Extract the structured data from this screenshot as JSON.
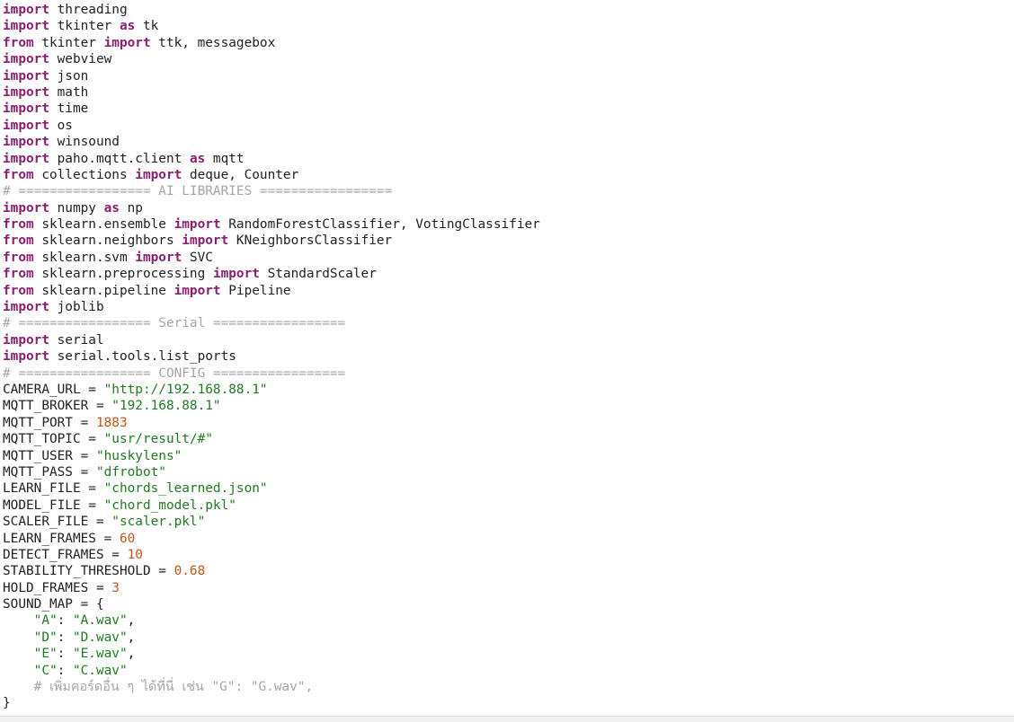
{
  "editor": {
    "lines": [
      [
        {
          "t": "kw",
          "v": "import"
        },
        {
          "t": "plain",
          "v": " threading"
        }
      ],
      [
        {
          "t": "kw",
          "v": "import"
        },
        {
          "t": "plain",
          "v": " tkinter "
        },
        {
          "t": "kw",
          "v": "as"
        },
        {
          "t": "plain",
          "v": " tk"
        }
      ],
      [
        {
          "t": "kw",
          "v": "from"
        },
        {
          "t": "plain",
          "v": " tkinter "
        },
        {
          "t": "kw",
          "v": "import"
        },
        {
          "t": "plain",
          "v": " ttk, messagebox"
        }
      ],
      [
        {
          "t": "kw",
          "v": "import"
        },
        {
          "t": "plain",
          "v": " webview"
        }
      ],
      [
        {
          "t": "kw",
          "v": "import"
        },
        {
          "t": "plain",
          "v": " json"
        }
      ],
      [
        {
          "t": "kw",
          "v": "import"
        },
        {
          "t": "plain",
          "v": " math"
        }
      ],
      [
        {
          "t": "kw",
          "v": "import"
        },
        {
          "t": "plain",
          "v": " time"
        }
      ],
      [
        {
          "t": "kw",
          "v": "import"
        },
        {
          "t": "plain",
          "v": " os"
        }
      ],
      [
        {
          "t": "kw",
          "v": "import"
        },
        {
          "t": "plain",
          "v": " winsound"
        }
      ],
      [
        {
          "t": "kw",
          "v": "import"
        },
        {
          "t": "plain",
          "v": " paho.mqtt.client "
        },
        {
          "t": "kw",
          "v": "as"
        },
        {
          "t": "plain",
          "v": " mqtt"
        }
      ],
      [
        {
          "t": "kw",
          "v": "from"
        },
        {
          "t": "plain",
          "v": " collections "
        },
        {
          "t": "kw",
          "v": "import"
        },
        {
          "t": "plain",
          "v": " deque, Counter"
        }
      ],
      [
        {
          "t": "com",
          "v": "# ================= AI LIBRARIES ================="
        }
      ],
      [
        {
          "t": "kw",
          "v": "import"
        },
        {
          "t": "plain",
          "v": " numpy "
        },
        {
          "t": "kw",
          "v": "as"
        },
        {
          "t": "plain",
          "v": " np"
        }
      ],
      [
        {
          "t": "kw",
          "v": "from"
        },
        {
          "t": "plain",
          "v": " sklearn.ensemble "
        },
        {
          "t": "kw",
          "v": "import"
        },
        {
          "t": "plain",
          "v": " RandomForestClassifier, VotingClassifier"
        }
      ],
      [
        {
          "t": "kw",
          "v": "from"
        },
        {
          "t": "plain",
          "v": " sklearn.neighbors "
        },
        {
          "t": "kw",
          "v": "import"
        },
        {
          "t": "plain",
          "v": " KNeighborsClassifier"
        }
      ],
      [
        {
          "t": "kw",
          "v": "from"
        },
        {
          "t": "plain",
          "v": " sklearn.svm "
        },
        {
          "t": "kw",
          "v": "import"
        },
        {
          "t": "plain",
          "v": " SVC"
        }
      ],
      [
        {
          "t": "kw",
          "v": "from"
        },
        {
          "t": "plain",
          "v": " sklearn.preprocessing "
        },
        {
          "t": "kw",
          "v": "import"
        },
        {
          "t": "plain",
          "v": " StandardScaler"
        }
      ],
      [
        {
          "t": "kw",
          "v": "from"
        },
        {
          "t": "plain",
          "v": " sklearn.pipeline "
        },
        {
          "t": "kw",
          "v": "import"
        },
        {
          "t": "plain",
          "v": " Pipeline"
        }
      ],
      [
        {
          "t": "kw",
          "v": "import"
        },
        {
          "t": "plain",
          "v": " joblib"
        }
      ],
      [
        {
          "t": "com",
          "v": "# ================= Serial ================="
        }
      ],
      [
        {
          "t": "kw",
          "v": "import"
        },
        {
          "t": "plain",
          "v": " serial"
        }
      ],
      [
        {
          "t": "kw",
          "v": "import"
        },
        {
          "t": "plain",
          "v": " serial.tools.list_ports"
        }
      ],
      [
        {
          "t": "com",
          "v": "# ================= CONFIG ================="
        }
      ],
      [
        {
          "t": "plain",
          "v": "CAMERA_URL = "
        },
        {
          "t": "str",
          "v": "\"http://192.168.88.1\""
        }
      ],
      [
        {
          "t": "plain",
          "v": "MQTT_BROKER = "
        },
        {
          "t": "str",
          "v": "\"192.168.88.1\""
        }
      ],
      [
        {
          "t": "plain",
          "v": "MQTT_PORT = "
        },
        {
          "t": "num",
          "v": "1883"
        }
      ],
      [
        {
          "t": "plain",
          "v": "MQTT_TOPIC = "
        },
        {
          "t": "str",
          "v": "\"usr/result/#\""
        }
      ],
      [
        {
          "t": "plain",
          "v": "MQTT_USER = "
        },
        {
          "t": "str",
          "v": "\"huskylens\""
        }
      ],
      [
        {
          "t": "plain",
          "v": "MQTT_PASS = "
        },
        {
          "t": "str",
          "v": "\"dfrobot\""
        }
      ],
      [
        {
          "t": "plain",
          "v": "LEARN_FILE = "
        },
        {
          "t": "str",
          "v": "\"chords_learned.json\""
        }
      ],
      [
        {
          "t": "plain",
          "v": "MODEL_FILE = "
        },
        {
          "t": "str",
          "v": "\"chord_model.pkl\""
        }
      ],
      [
        {
          "t": "plain",
          "v": "SCALER_FILE = "
        },
        {
          "t": "str",
          "v": "\"scaler.pkl\""
        }
      ],
      [
        {
          "t": "plain",
          "v": "LEARN_FRAMES = "
        },
        {
          "t": "num",
          "v": "60"
        }
      ],
      [
        {
          "t": "plain",
          "v": "DETECT_FRAMES = "
        },
        {
          "t": "num",
          "v": "10"
        }
      ],
      [
        {
          "t": "plain",
          "v": "STABILITY_THRESHOLD = "
        },
        {
          "t": "num",
          "v": "0.68"
        }
      ],
      [
        {
          "t": "plain",
          "v": "HOLD_FRAMES = "
        },
        {
          "t": "num",
          "v": "3"
        }
      ],
      [
        {
          "t": "plain",
          "v": "SOUND_MAP = {"
        }
      ],
      [
        {
          "t": "plain",
          "v": "    "
        },
        {
          "t": "str",
          "v": "\"A\""
        },
        {
          "t": "plain",
          "v": ": "
        },
        {
          "t": "str",
          "v": "\"A.wav\""
        },
        {
          "t": "plain",
          "v": ","
        }
      ],
      [
        {
          "t": "plain",
          "v": "    "
        },
        {
          "t": "str",
          "v": "\"D\""
        },
        {
          "t": "plain",
          "v": ": "
        },
        {
          "t": "str",
          "v": "\"D.wav\""
        },
        {
          "t": "plain",
          "v": ","
        }
      ],
      [
        {
          "t": "plain",
          "v": "    "
        },
        {
          "t": "str",
          "v": "\"E\""
        },
        {
          "t": "plain",
          "v": ": "
        },
        {
          "t": "str",
          "v": "\"E.wav\""
        },
        {
          "t": "plain",
          "v": ","
        }
      ],
      [
        {
          "t": "plain",
          "v": "    "
        },
        {
          "t": "str",
          "v": "\"C\""
        },
        {
          "t": "plain",
          "v": ": "
        },
        {
          "t": "str",
          "v": "\"C.wav\""
        }
      ],
      [
        {
          "t": "plain",
          "v": "    "
        },
        {
          "t": "com",
          "v": "# เพิ่มคอร์ดอื่น ๆ ได้ที่นี่ เช่น \"G\": \"G.wav\","
        }
      ],
      [
        {
          "t": "plain",
          "v": "}"
        }
      ]
    ]
  },
  "colors": {
    "keyword": "#8a1e6f",
    "string": "#217a21",
    "number": "#c0561a",
    "comment": "#a6a6a6",
    "text": "#222222",
    "background": "#ffffff"
  }
}
